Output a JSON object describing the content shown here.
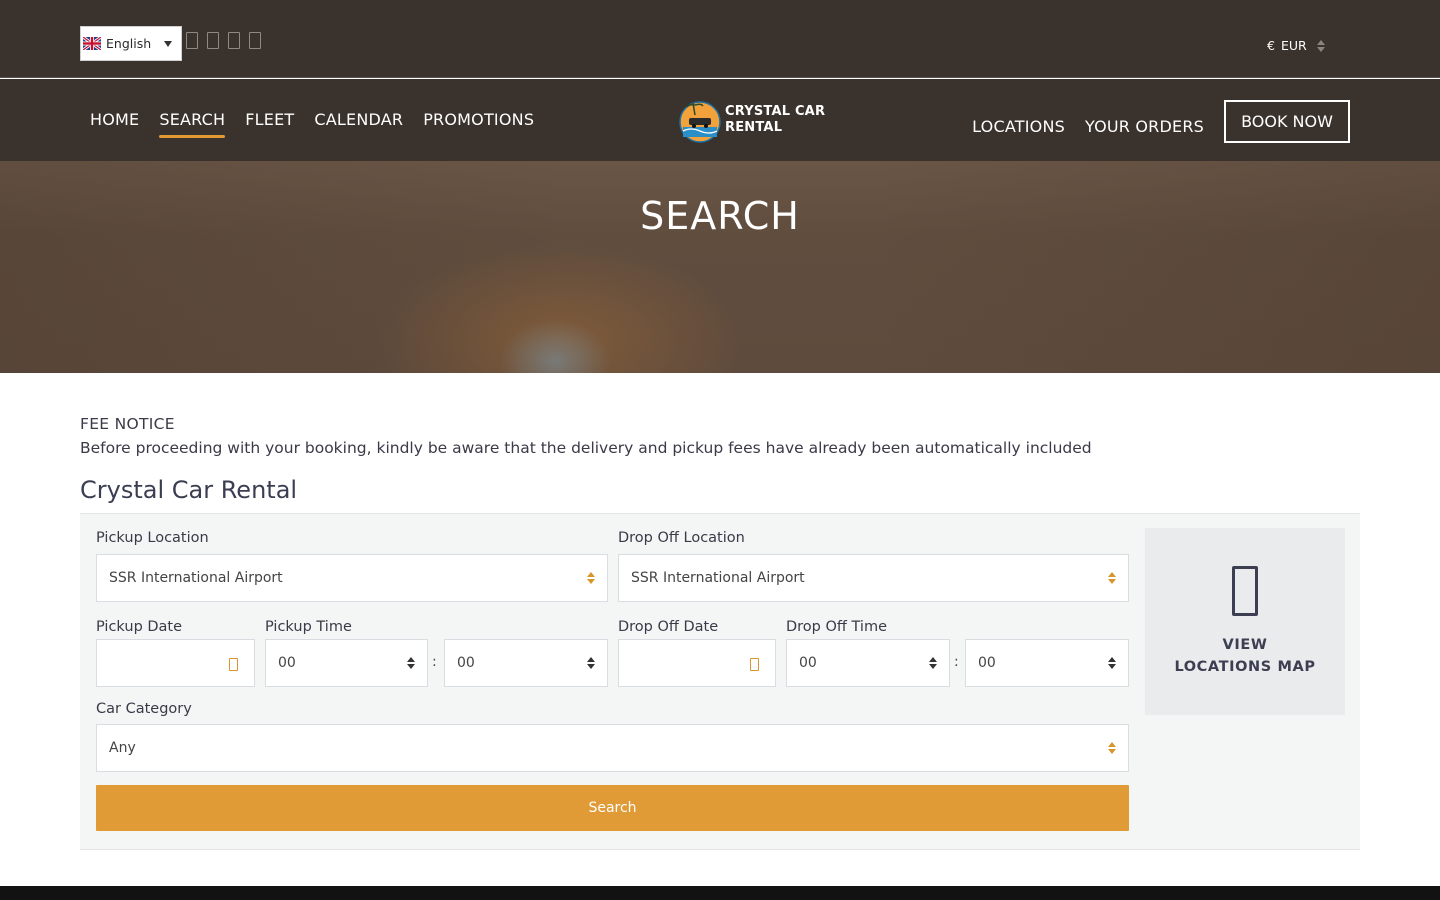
{
  "header": {
    "language": {
      "label": "English",
      "flag": "uk-flag-icon"
    },
    "social_icons": [
      "facebook-icon",
      "instagram-icon",
      "twitter-icon",
      "tiktok-icon"
    ],
    "currency": {
      "symbol": "€",
      "code": "EUR"
    }
  },
  "nav": {
    "left": [
      "HOME",
      "SEARCH",
      "FLEET",
      "CALENDAR",
      "PROMOTIONS"
    ],
    "active": "SEARCH",
    "logo": {
      "line1": "CRYSTAL CAR",
      "line2": "RENTAL"
    },
    "right": [
      "LOCATIONS",
      "YOUR ORDERS"
    ],
    "cta": "BOOK NOW"
  },
  "hero": {
    "title": "SEARCH"
  },
  "notice": {
    "title": "FEE NOTICE",
    "text": "Before proceeding with your booking, kindly be aware that the delivery and pickup fees have already been automatically included"
  },
  "company": {
    "name": "Crystal Car Rental"
  },
  "form": {
    "pickup_location": {
      "label": "Pickup Location",
      "value": "SSR International Airport"
    },
    "dropoff_location": {
      "label": "Drop Off Location",
      "value": "SSR International Airport"
    },
    "pickup_date": {
      "label": "Pickup Date",
      "value": ""
    },
    "pickup_time": {
      "label": "Pickup Time",
      "hour": "00",
      "minute": "00",
      "sep": ":"
    },
    "dropoff_date": {
      "label": "Drop Off Date",
      "value": ""
    },
    "dropoff_time": {
      "label": "Drop Off Time",
      "hour": "00",
      "minute": "00",
      "sep": ":"
    },
    "car_category": {
      "label": "Car Category",
      "value": "Any"
    },
    "submit": "Search"
  },
  "map_card": {
    "icon": "map-icon",
    "line1": "VIEW",
    "line2": "LOCATIONS MAP"
  },
  "colors": {
    "header_bg": "#3a322c",
    "accent": "#e09a36",
    "text": "#3a3a48"
  }
}
